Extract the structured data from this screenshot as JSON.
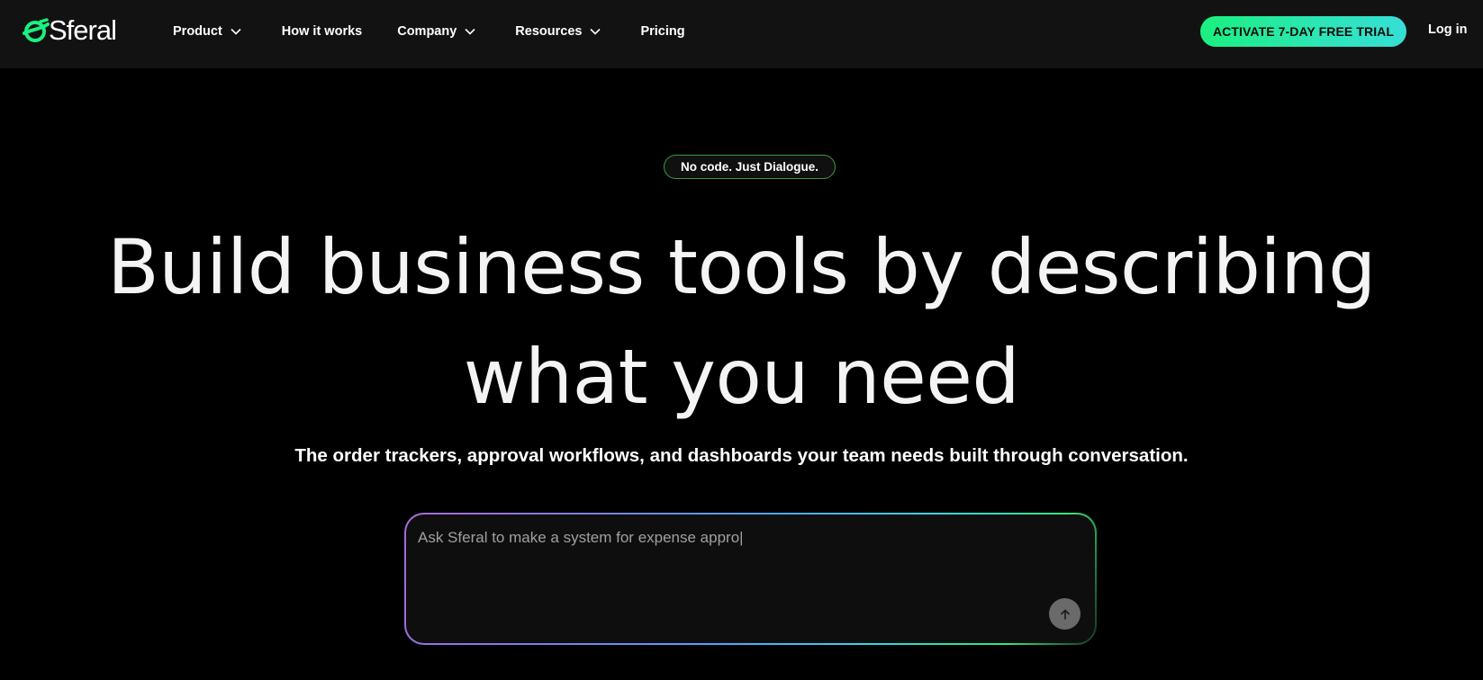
{
  "brand": {
    "name": "Sferal",
    "accent_color": "#1bf07f",
    "icon": "sferal-logo-icon"
  },
  "nav": {
    "items": [
      {
        "label": "Product",
        "has_dropdown": true
      },
      {
        "label": "How it works",
        "has_dropdown": false
      },
      {
        "label": "Company",
        "has_dropdown": true
      },
      {
        "label": "Resources",
        "has_dropdown": true
      },
      {
        "label": "Pricing",
        "has_dropdown": false
      }
    ],
    "dropdown_icon": "chevron-down-icon"
  },
  "header_actions": {
    "trial_label": "ACTIVATE 7-DAY FREE TRIAL",
    "login_label": "Log in"
  },
  "hero": {
    "badge": "No code. Just Dialogue.",
    "headline_line1": "Build business tools by describing",
    "headline_line2": "what you need",
    "subhead": "The order trackers, approval workflows, and dashboards your team needs built through conversation."
  },
  "prompt": {
    "value": "Ask Sferal to make a system for expense appro|",
    "send_icon": "arrow-up-icon"
  }
}
